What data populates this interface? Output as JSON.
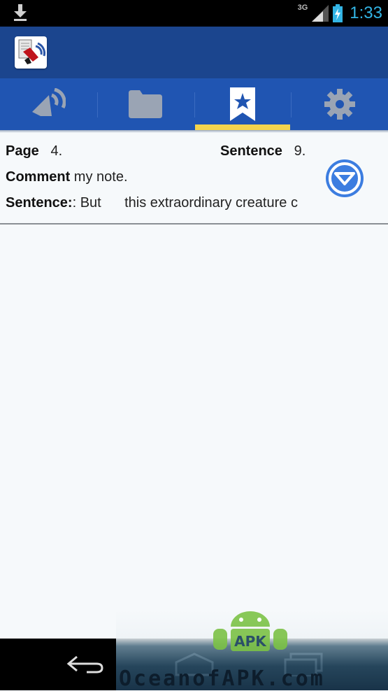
{
  "status_bar": {
    "network": "3G",
    "time": "1:33",
    "icons": [
      "download-icon",
      "signal-icon",
      "battery-charging-icon"
    ]
  },
  "action_bar": {
    "app_icon": "app-logo-icon"
  },
  "tabs": [
    {
      "icon": "speaker-icon",
      "active": false
    },
    {
      "icon": "folder-icon",
      "active": false
    },
    {
      "icon": "bookmark-star-icon",
      "active": true
    },
    {
      "icon": "gear-icon",
      "active": false
    }
  ],
  "bookmark": {
    "page_label": "Page",
    "page_value": "4.",
    "sentence_label": "Sentence",
    "sentence_value": "9.",
    "comment_label": "Comment",
    "comment_value": "my note.",
    "sentence_text_label": "Sentence:",
    "sentence_text_value": ": But      this extraordinary creature c",
    "collapse_icon": "collapse-down-icon"
  },
  "nav_bar": {
    "icons": [
      "back-icon",
      "home-icon",
      "recent-apps-icon"
    ]
  },
  "watermark": {
    "text": "OceanofAPK.com",
    "badge": "APK"
  },
  "colors": {
    "action_bar": "#1b458e",
    "tab_bar": "#2055b2",
    "tab_indicator": "#f4d44d",
    "accent": "#33b5e5",
    "collapse_button": "#3c7de0"
  }
}
